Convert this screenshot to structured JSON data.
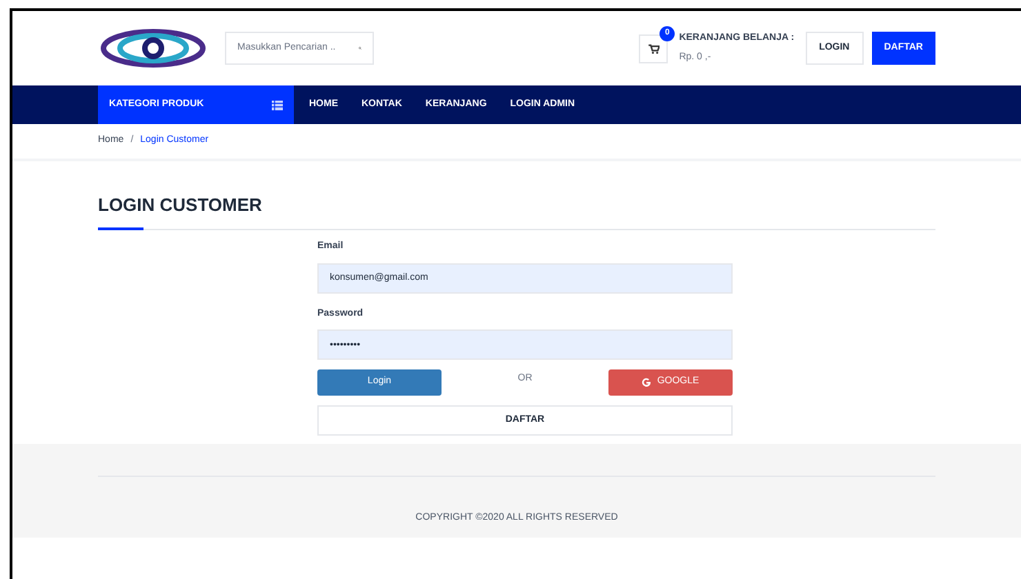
{
  "header": {
    "search": {
      "placeholder": "Masukkan Pencarian .."
    },
    "cart": {
      "count": "0",
      "title": "KERANJANG BELANJA :",
      "total": "Rp. 0 ,-"
    },
    "buttons": [
      {
        "label": "LOGIN",
        "kind": "outline"
      },
      {
        "label": "DAFTAR",
        "kind": "primary"
      }
    ]
  },
  "nav": {
    "category": "KATEGORI PRODUK",
    "items": [
      {
        "label": "HOME"
      },
      {
        "label": "KONTAK"
      },
      {
        "label": "KERANJANG"
      },
      {
        "label": "LOGIN ADMIN"
      }
    ]
  },
  "breadcrumb_separator": "/",
  "breadcrumb": [
    {
      "label": "Home",
      "current": false
    },
    {
      "label": "Login Customer",
      "current": true
    }
  ],
  "page_title": "LOGIN CUSTOMER",
  "form": {
    "fields": [
      {
        "label": "Email",
        "value": "konsumen@gmail.com"
      },
      {
        "label": "Password",
        "value": "•••••••••"
      }
    ],
    "login": "Login",
    "or": "OR",
    "google": "GOOGLE",
    "register": "DAFTAR"
  },
  "footer": {
    "copyright": "COPYRIGHT ©2020 ALL RIGHTS RESERVED"
  }
}
